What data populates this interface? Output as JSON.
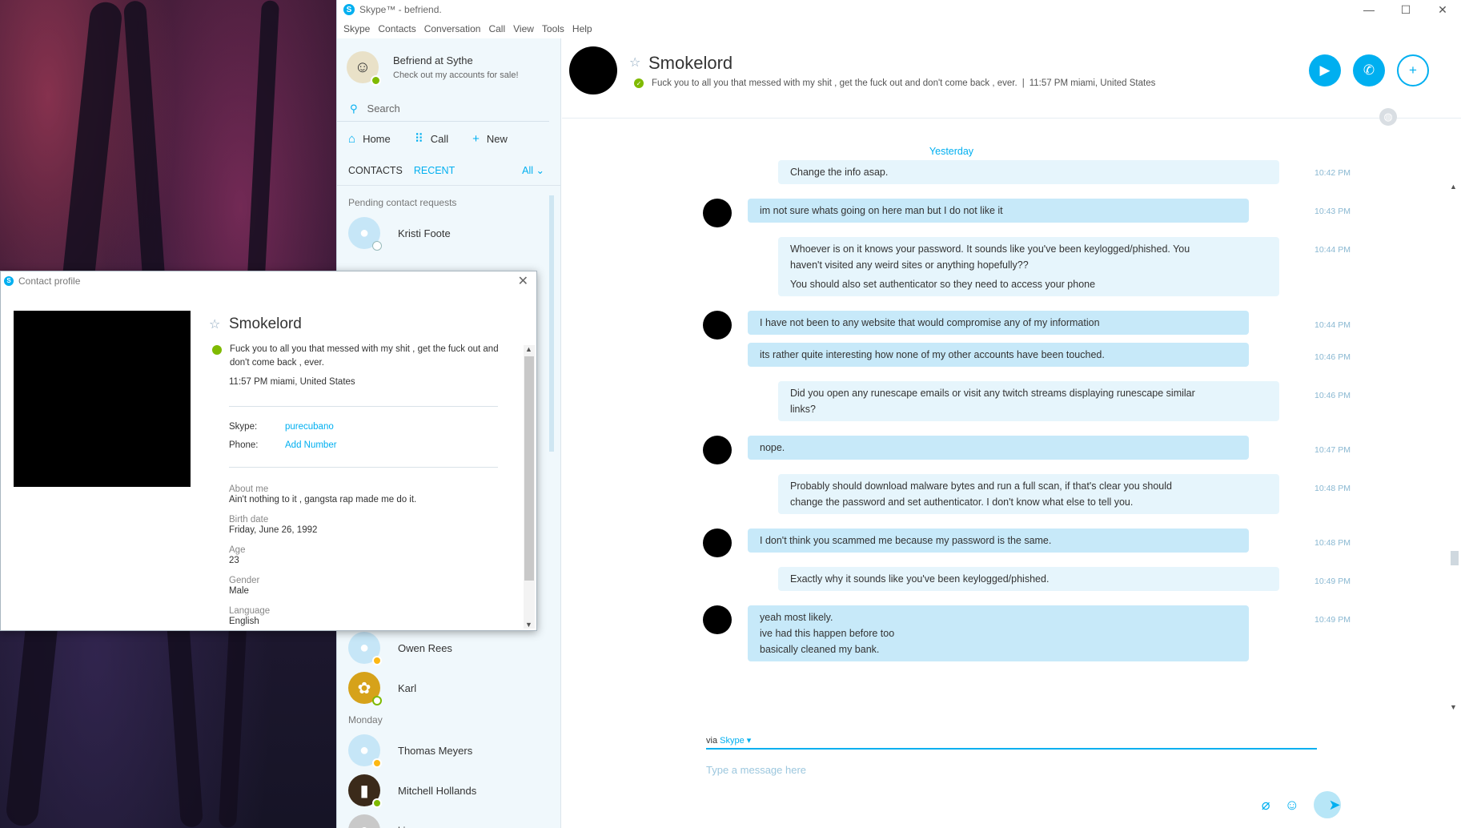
{
  "window": {
    "title": "Skype™ - befriend.",
    "logo": "S",
    "controls": [
      "—",
      "☐",
      "✕"
    ]
  },
  "menu": [
    "Skype",
    "Contacts",
    "Conversation",
    "Call",
    "View",
    "Tools",
    "Help"
  ],
  "profile": {
    "name": "Befriend at Sythe",
    "mood": "Check out my accounts for sale!"
  },
  "search": {
    "placeholder": "Search"
  },
  "nav": {
    "home": "Home",
    "call": "Call",
    "new": "New"
  },
  "tabs": {
    "contacts": "CONTACTS",
    "recent": "RECENT",
    "filter": "All"
  },
  "pending_label": "Pending contact requests",
  "contacts_top": [
    {
      "name": "Kristi Foote",
      "status": "pending"
    }
  ],
  "contacts_bottom": [
    {
      "name": "Owen Rees",
      "status": "away",
      "avatar": "default"
    },
    {
      "name": "Karl",
      "status": "online",
      "avatar": "yellow"
    }
  ],
  "monday_label": "Monday",
  "contacts_monday": [
    {
      "name": "Thomas Meyers",
      "status": "away",
      "avatar": "default"
    },
    {
      "name": "Mitchell Hollands",
      "status": "online",
      "avatar": "dark"
    },
    {
      "name": "king",
      "status": "none",
      "avatar": "grey"
    }
  ],
  "conversation": {
    "name": "Smokelord",
    "mood": "Fuck you to all you that messed with my shit , get the fuck out and don't come back , ever.",
    "separator": "|",
    "local_time": "11:57 PM miami, United States",
    "day_label": "Yesterday",
    "messages": [
      {
        "from": "me",
        "lines": [
          "Change the info asap."
        ],
        "time": "10:42 PM"
      },
      {
        "from": "them",
        "lines": [
          "im not sure whats going on here man but I do not like it"
        ],
        "time": "10:43 PM"
      },
      {
        "from": "me",
        "lines": [
          "Whoever is on it knows your password. It sounds like you've been keylogged/phished. You",
          "haven't visited any weird sites or anything hopefully??",
          "You should also set authenticator so they need to access your phone"
        ],
        "time": "10:44 PM"
      },
      {
        "from": "them",
        "lines": [
          "I have not been to any website that would compromise any of my information"
        ],
        "time": "10:44 PM"
      },
      {
        "from": "them",
        "lines": [
          "its rather quite interesting how none of my other accounts have been touched."
        ],
        "time": "10:46 PM"
      },
      {
        "from": "me",
        "lines": [
          "Did you open any runescape emails or visit any twitch streams displaying runescape similar",
          "links?"
        ],
        "time": "10:46 PM"
      },
      {
        "from": "them",
        "lines": [
          "nope."
        ],
        "time": "10:47 PM"
      },
      {
        "from": "me",
        "lines": [
          "Probably should download malware bytes and run a full scan, if that's clear you should",
          "change the password and set authenticator. I don't know what else to tell you."
        ],
        "time": "10:48 PM"
      },
      {
        "from": "them",
        "lines": [
          "I don't think you scammed me because my password is the same."
        ],
        "time": "10:48 PM"
      },
      {
        "from": "me",
        "lines": [
          "Exactly why it sounds like you've been keylogged/phished."
        ],
        "time": "10:49 PM"
      },
      {
        "from": "them",
        "lines": [
          "yeah most likely.",
          "ive had this happen before too",
          "basically cleaned my bank."
        ],
        "time": "10:49 PM"
      }
    ],
    "via_prefix": "via",
    "via_service": "Skype",
    "compose_placeholder": "Type a message here"
  },
  "popup": {
    "title": "Contact profile",
    "name": "Smokelord",
    "mood": "Fuck you to all you that messed with my shit , get the fuck out and don't come back , ever.",
    "local_time": "11:57 PM miami, United States",
    "skype_label": "Skype:",
    "skype_value": "purecubano",
    "phone_label": "Phone:",
    "phone_value": "Add Number",
    "fields": [
      {
        "label": "About me",
        "value": "Ain't nothing to it , gangsta rap made me do it."
      },
      {
        "label": "Birth date",
        "value": "Friday, June 26, 1992"
      },
      {
        "label": "Age",
        "value": "23"
      },
      {
        "label": "Gender",
        "value": "Male"
      },
      {
        "label": "Language",
        "value": "English"
      }
    ]
  },
  "colors": {
    "accent": "#00aff0",
    "online": "#7fba00",
    "away": "#fdb813",
    "bubble_in": "#c7e9f9",
    "bubble_out": "#e6f5fc"
  }
}
